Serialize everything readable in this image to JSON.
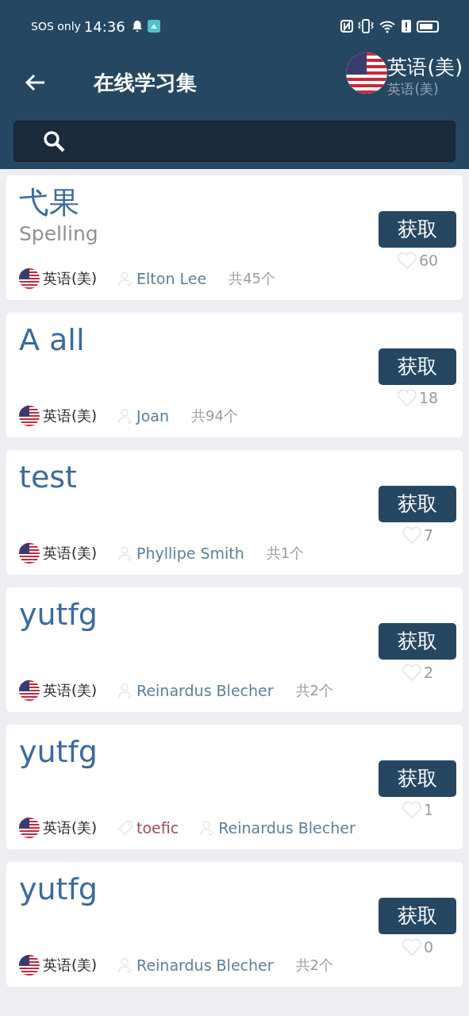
{
  "status_bar": {
    "carrier": "SOS only",
    "time": "14:36"
  },
  "app_bar": {
    "title": "在线学习集",
    "language": "英语(美)",
    "language_sub": "英语(美)"
  },
  "sets": [
    {
      "title": "弋果",
      "subtitle": "Spelling",
      "language": "英语(美)",
      "author": "Elton Lee",
      "count": "共45个",
      "button": "获取",
      "likes": "60"
    },
    {
      "title": "A all",
      "language": "英语(美)",
      "author": "Joan",
      "count": "共94个",
      "button": "获取",
      "likes": "18"
    },
    {
      "title": "test",
      "language": "英语(美)",
      "author": "Phyllipe Smith",
      "count": "共1个",
      "button": "获取",
      "likes": "7"
    },
    {
      "title": "yutfg",
      "language": "英语(美)",
      "author": "Reinardus Blecher",
      "count": "共2个",
      "button": "获取",
      "likes": "2"
    },
    {
      "title": "yutfg",
      "language": "英语(美)",
      "tag": "toefic",
      "author": "Reinardus Blecher",
      "button": "获取",
      "likes": "1"
    },
    {
      "title": "yutfg",
      "language": "英语(美)",
      "author": "Reinardus Blecher",
      "count": "共2个",
      "button": "获取",
      "likes": "0"
    }
  ]
}
